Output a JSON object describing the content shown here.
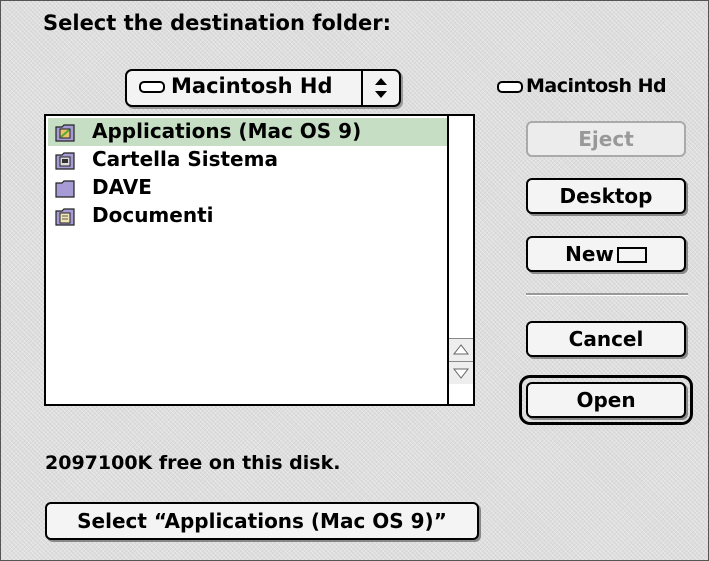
{
  "dialog": {
    "prompt": "Select the destination folder:",
    "popup_value": "Macintosh Hd",
    "disk_name": "Macintosh Hd",
    "free_space": "2097100K free on this disk.",
    "select_button": "Select “Applications (Mac OS 9)”"
  },
  "file_list": [
    {
      "name": "Applications (Mac OS 9)",
      "icon": "applications-folder-icon",
      "selected": true
    },
    {
      "name": "Cartella Sistema",
      "icon": "system-folder-icon",
      "selected": false
    },
    {
      "name": "DAVE",
      "icon": "folder-icon",
      "selected": false
    },
    {
      "name": "Documenti",
      "icon": "documents-folder-icon",
      "selected": false
    }
  ],
  "buttons": {
    "eject": "Eject",
    "desktop": "Desktop",
    "new": "New",
    "cancel": "Cancel",
    "open": "Open"
  },
  "colors": {
    "selection": "#c6dfc4",
    "background": "#dddddd"
  }
}
